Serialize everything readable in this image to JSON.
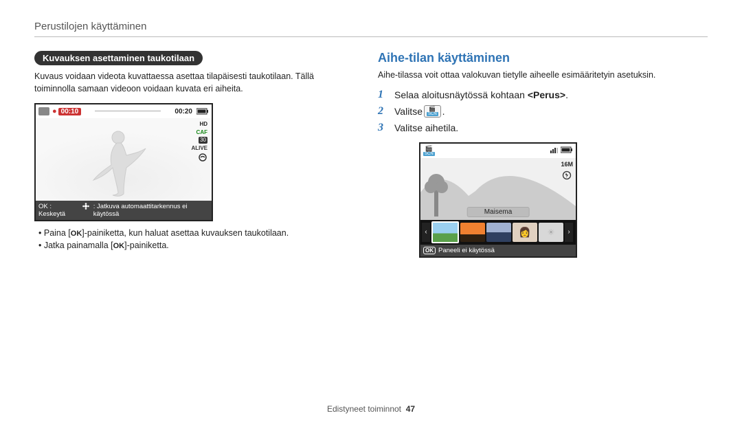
{
  "header": {
    "section_title": "Perustilojen käyttäminen"
  },
  "left": {
    "pill_title": "Kuvauksen asettaminen taukotilaan",
    "intro": "Kuvaus voidaan videota kuvattaessa asettaa tilapäisesti taukotilaan. Tällä toiminnolla samaan videoon voidaan kuvata eri aiheita.",
    "screen": {
      "rec_time": "00:10",
      "total_time": "00:20",
      "hd_label": "HD",
      "caf_label": "CAF",
      "fps_label": "30",
      "alive_label": "ALIVE",
      "footer_ok": "OK : Keskeytä",
      "footer_note": ": Jatkuva automaattitarkennus ei käytössä"
    },
    "bullets": {
      "b1_pre": "Paina [",
      "b1_post": "]-painiketta, kun haluat asettaa kuvauksen taukotilaan.",
      "b2_pre": "Jatka painamalla [",
      "b2_post": "]-painiketta."
    }
  },
  "right": {
    "heading": "Aihe-tilan käyttäminen",
    "intro": "Aihe-tilassa voit ottaa valokuvan tietylle aiheelle esimääritetyin asetuksin.",
    "steps": {
      "s1_text_pre": "Selaa aloitusnäytössä kohtaan ",
      "s1_bold": "<Perus>",
      "s1_suffix": ".",
      "s2_text": "Valitse",
      "s2_suffix": ".",
      "s3_text": "Valitse aihetila."
    },
    "screen": {
      "scn_label": "SCN",
      "res_label": "16M",
      "scene_label": "Maisema",
      "footer_text": "Paneeli ei käytössä"
    }
  },
  "footer": {
    "text": "Edistyneet toiminnot",
    "page": "47"
  },
  "nums": {
    "n1": "1",
    "n2": "2",
    "n3": "3"
  },
  "labels": {
    "ok": "OK"
  }
}
